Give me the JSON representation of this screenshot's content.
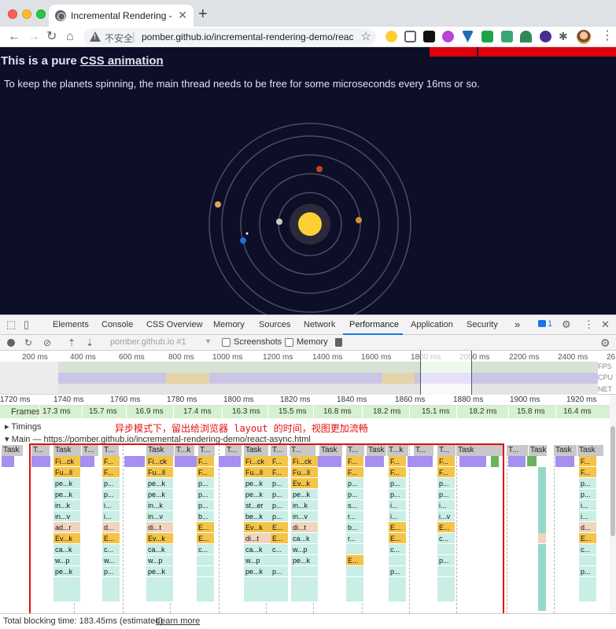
{
  "browser": {
    "tab_title": "Incremental Rendering - React",
    "security_label": "不安全",
    "url": "pomber.github.io/incremental-rendering-demo/reac..."
  },
  "page": {
    "title_prefix": "This is a pure ",
    "title_link": "CSS animation",
    "description": "To keep the planets spinning, the main thread needs to be free for some microseconds every 16ms or so."
  },
  "devtools": {
    "tabs": [
      "Elements",
      "Console",
      "CSS Overview",
      "Memory",
      "Sources",
      "Network",
      "Performance",
      "Application",
      "Security"
    ],
    "active_tab": "Performance",
    "more": "»",
    "issues_count": "1"
  },
  "perf_toolbar": {
    "profile_select": "pomber.github.io #1",
    "screenshots_label": "Screenshots",
    "memory_label": "Memory"
  },
  "overview": {
    "ticks": [
      "200 ms",
      "400 ms",
      "600 ms",
      "800 ms",
      "1000 ms",
      "1200 ms",
      "1400 ms",
      "1600 ms",
      "1800 ms",
      "2000 ms",
      "2200 ms",
      "2400 ms",
      "26"
    ],
    "fps_label": "FPS",
    "cpu_label": "CPU",
    "net_label": "NET"
  },
  "ruler": [
    "1720 ms",
    "1740 ms",
    "1760 ms",
    "1780 ms",
    "1800 ms",
    "1820 ms",
    "1840 ms",
    "1860 ms",
    "1880 ms",
    "1900 ms",
    "1920 ms"
  ],
  "frames": {
    "label": "Frames",
    "values": [
      "17.3 ms",
      "15.7 ms",
      "16.9 ms",
      "17.4 ms",
      "16.3 ms",
      "15.5 ms",
      "16.8 ms",
      "18.2 ms",
      "15.1 ms",
      "18.2 ms",
      "15.8 ms",
      "16.4 ms"
    ]
  },
  "timings_label": "Timings",
  "annotation": "异步模式下，留出给浏览器 layout 的时间，视图更加流畅",
  "main_label": "Main — https://pomber.github.io/incremental-rendering-demo/react-async.html",
  "tasks": [
    "Task",
    "T...",
    "Task",
    "T...",
    "T...",
    "Task",
    "T...k",
    "T...",
    "T...",
    "Task",
    "T...",
    "T...",
    "Task",
    "T...",
    "Task",
    "T...k",
    "T...",
    "T...",
    "Task",
    "T...",
    "Task",
    "Task",
    "Task",
    "T...",
    "T..."
  ],
  "flame_columns": [
    {
      "cells": [
        "Fi...ck",
        "Fu...ll",
        "pe...k",
        "pe...k",
        "in...k",
        "in...v",
        "ad...r",
        "Ev...k",
        "ca...k",
        "w...p",
        "pe...k"
      ]
    },
    {
      "cells": [
        "F...",
        "F...",
        "p...",
        "p...",
        "i...",
        "i...",
        "d...",
        "E...",
        "c...",
        "w...",
        "p..."
      ]
    },
    {
      "cells": [
        "Fi...ck",
        "Fu...ll",
        "pe...k",
        "pe...k",
        "in...k",
        "in...v",
        "di...t",
        "Ev...k",
        "ca...k",
        "w...p",
        "pe...k"
      ]
    },
    {
      "cells": [
        "F...",
        "F...",
        "p...",
        "p...",
        "p...",
        "b...",
        "E...",
        "E...",
        "c...",
        "",
        ""
      ]
    },
    {
      "cells": [
        "Fi...ck",
        "Fu...ll",
        "pe...k",
        "pe...k",
        "st...er",
        "be...k",
        "Ev...k",
        "di...t",
        "ca...k",
        "w...p",
        "pe...k"
      ]
    },
    {
      "cells": [
        "F...",
        "F...",
        "p...",
        "p...",
        "p...",
        "p...",
        "E...",
        "E...",
        "c...",
        "",
        "p..."
      ]
    },
    {
      "cells": [
        "Fi...ck",
        "Fu...ll",
        "Ev...k",
        "pe...k",
        "in...k",
        "in...v",
        "di...t",
        "ca...k",
        "w...p",
        "pe...k",
        ""
      ]
    },
    {
      "cells": [
        "F...",
        "F...",
        "p...",
        "p...",
        "s...",
        "r...",
        "b...",
        "r...",
        "",
        "E...",
        ""
      ]
    },
    {
      "cells": [
        "F...",
        "F...",
        "p...",
        "p...",
        "i...",
        "i...",
        "E...",
        "E...",
        "c...",
        "",
        "p..."
      ]
    },
    {
      "cells": [
        "F...",
        "F...",
        "p...",
        "p...",
        "i...",
        "i...v",
        "E...",
        "c...",
        "",
        "p...",
        ""
      ]
    },
    {
      "cells": [
        "F...",
        "F...",
        "p...",
        "p...",
        "i...",
        "i...",
        "d...",
        "E...",
        "c...",
        "",
        "p..."
      ]
    }
  ],
  "status": {
    "text": "Total blocking time: 183.45ms (estimated)",
    "learn_more": "Learn more"
  },
  "colors": {
    "page_bg": "#0d0f28",
    "annotation_red": "#e01010",
    "task_yellow": "#f4c449",
    "task_teal": "#c9eee6",
    "purple": "#a58ff0"
  }
}
